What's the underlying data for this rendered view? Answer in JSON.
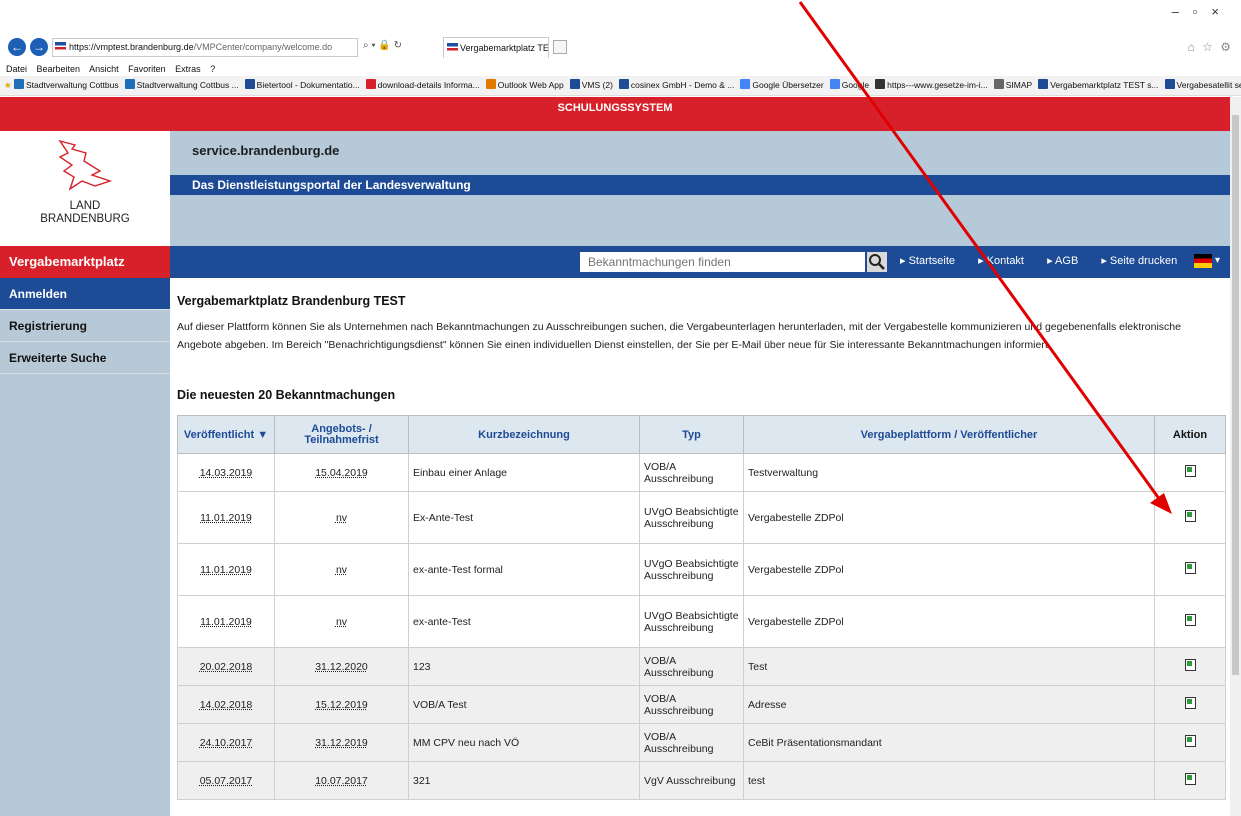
{
  "browser": {
    "url_host": "https://vmptest.brandenburg.de",
    "url_path": "/VMPCenter/company/welcome.do",
    "tab_title": "Vergabemarktplatz TEST | s...",
    "menu": [
      "Datei",
      "Bearbeiten",
      "Ansicht",
      "Favoriten",
      "Extras",
      "?"
    ],
    "favorites": [
      {
        "label": "Stadtverwaltung Cottbus",
        "color": "#1d6fb8"
      },
      {
        "label": "Stadtverwaltung Cottbus ...",
        "color": "#1d6fb8"
      },
      {
        "label": "Bietertool - Dokumentatio...",
        "color": "#1d4b96"
      },
      {
        "label": "download-details Informa...",
        "color": "#d8202a"
      },
      {
        "label": "Outlook Web App",
        "color": "#e07b00"
      },
      {
        "label": "VMS (2)",
        "color": "#1d4b96"
      },
      {
        "label": "cosinex GmbH - Demo & ...",
        "color": "#1d4b96"
      },
      {
        "label": "Google Übersetzer",
        "color": "#4285f4"
      },
      {
        "label": "Google",
        "color": "#4285f4"
      },
      {
        "label": "https---www.gesetze-im-i...",
        "color": "#333333"
      },
      {
        "label": "SIMAP",
        "color": "#666666"
      },
      {
        "label": "Vergabemarktplatz TEST s...",
        "color": "#1d4b96"
      },
      {
        "label": "Vergabesatellit service.bra...",
        "color": "#1d4b96"
      }
    ]
  },
  "banner": "SCHULUNGSSYSTEM",
  "logo": {
    "line1": "LAND",
    "line2": "BRANDENBURG"
  },
  "header": {
    "site": "service.brandenburg.de",
    "subtitle": "Das Dienstleistungsportal der Landesverwaltung"
  },
  "sidebar": {
    "title": "Vergabemarktplatz",
    "items": [
      {
        "label": "Anmelden"
      },
      {
        "label": "Registrierung"
      },
      {
        "label": "Erweiterte Suche"
      }
    ]
  },
  "topnav": {
    "search_placeholder": "Bekanntmachungen finden",
    "links": [
      "Startseite",
      "Kontakt",
      "AGB",
      "Seite drucken"
    ]
  },
  "main": {
    "title": "Vergabemarktplatz Brandenburg TEST",
    "intro": "Auf dieser Plattform können Sie als Unternehmen nach Bekanntmachungen zu Ausschreibungen suchen, die Vergabeunterlagen herunterladen, mit der Vergabestelle kommunizieren und gegebenenfalls elektronische Angebote abgeben. Im Bereich \"Benachrichtigungsdienst\" können Sie einen individuellen Dienst einstellen, der Sie per E-Mail über neue für Sie interessante Bekanntmachungen informiert.",
    "list_title": "Die neuesten 20 Bekanntmachungen",
    "columns": [
      "Veröffentlicht",
      "Angebots- / Teilnahmefrist",
      "Kurzbezeichnung",
      "Typ",
      "Vergabeplattform / Veröffentlicher",
      "Aktion"
    ],
    "rows": [
      {
        "published": "14.03.2019",
        "deadline": "15.04.2019",
        "name": "Einbau einer Anlage",
        "type": "VOB/A Ausschreibung",
        "publisher": "Testverwaltung"
      },
      {
        "published": "11.01.2019",
        "deadline": "nv",
        "name": "Ex-Ante-Test",
        "type": "UVgO Beabsichtigte Ausschreibung",
        "publisher": "Vergabestelle ZDPol"
      },
      {
        "published": "11.01.2019",
        "deadline": "nv",
        "name": "ex-ante-Test formal",
        "type": "UVgO Beabsichtigte Ausschreibung",
        "publisher": "Vergabestelle ZDPol"
      },
      {
        "published": "11.01.2019",
        "deadline": "nv",
        "name": "ex-ante-Test",
        "type": "UVgO Beabsichtigte Ausschreibung",
        "publisher": "Vergabestelle ZDPol"
      },
      {
        "published": "20.02.2018",
        "deadline": "31.12.2020",
        "name": "123",
        "type": "VOB/A Ausschreibung",
        "publisher": "Test"
      },
      {
        "published": "14.02.2018",
        "deadline": "15.12.2019",
        "name": "VOB/A Test",
        "type": "VOB/A Ausschreibung",
        "publisher": "Adresse"
      },
      {
        "published": "24.10.2017",
        "deadline": "31.12.2019",
        "name": "MM CPV neu nach VÖ",
        "type": "VOB/A Ausschreibung",
        "publisher": "CeBit Präsentationsmandant"
      },
      {
        "published": "05.07.2017",
        "deadline": "10.07.2017",
        "name": "321",
        "type": "VgV Ausschreibung",
        "publisher": "test"
      }
    ]
  },
  "colors": {
    "red": "#d8202a",
    "blue": "#1d4b96",
    "header_gray": "#b5c9d8",
    "annotation_arrow": "#e00000"
  }
}
